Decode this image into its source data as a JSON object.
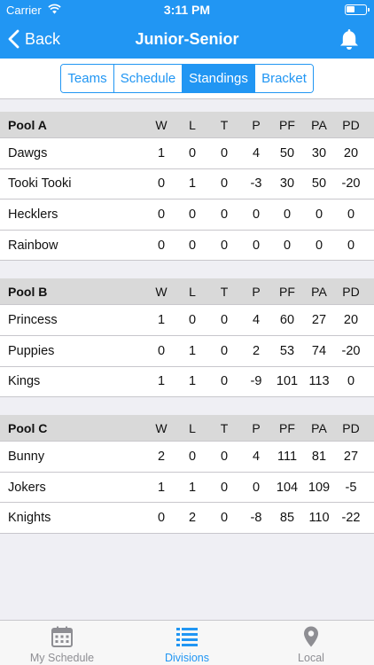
{
  "status_bar": {
    "carrier": "Carrier",
    "time": "3:11 PM"
  },
  "nav": {
    "back_label": "Back",
    "title": "Junior-Senior"
  },
  "segments": [
    {
      "label": "Teams",
      "selected": false
    },
    {
      "label": "Schedule",
      "selected": false
    },
    {
      "label": "Standings",
      "selected": true
    },
    {
      "label": "Bracket",
      "selected": false
    }
  ],
  "columns": [
    "W",
    "L",
    "T",
    "P",
    "PF",
    "PA",
    "PD"
  ],
  "pools": [
    {
      "name": "Pool A",
      "teams": [
        {
          "name": "Dawgs",
          "stats": [
            "1",
            "0",
            "0",
            "4",
            "50",
            "30",
            "20"
          ]
        },
        {
          "name": "Tooki Tooki",
          "stats": [
            "0",
            "1",
            "0",
            "-3",
            "30",
            "50",
            "-20"
          ]
        },
        {
          "name": "Hecklers",
          "stats": [
            "0",
            "0",
            "0",
            "0",
            "0",
            "0",
            "0"
          ]
        },
        {
          "name": "Rainbow",
          "stats": [
            "0",
            "0",
            "0",
            "0",
            "0",
            "0",
            "0"
          ]
        }
      ]
    },
    {
      "name": "Pool B",
      "teams": [
        {
          "name": "Princess",
          "stats": [
            "1",
            "0",
            "0",
            "4",
            "60",
            "27",
            "20"
          ]
        },
        {
          "name": "Puppies",
          "stats": [
            "0",
            "1",
            "0",
            "2",
            "53",
            "74",
            "-20"
          ]
        },
        {
          "name": "Kings",
          "stats": [
            "1",
            "1",
            "0",
            "-9",
            "101",
            "113",
            "0"
          ]
        }
      ]
    },
    {
      "name": "Pool C",
      "teams": [
        {
          "name": "Bunny",
          "stats": [
            "2",
            "0",
            "0",
            "4",
            "111",
            "81",
            "27"
          ]
        },
        {
          "name": "Jokers",
          "stats": [
            "1",
            "1",
            "0",
            "0",
            "104",
            "109",
            "-5"
          ]
        },
        {
          "name": "Knights",
          "stats": [
            "0",
            "2",
            "0",
            "-8",
            "85",
            "110",
            "-22"
          ]
        }
      ]
    }
  ],
  "tabs": [
    {
      "label": "My Schedule",
      "icon": "calendar-icon",
      "active": false
    },
    {
      "label": "Divisions",
      "icon": "list-icon",
      "active": true
    },
    {
      "label": "Local",
      "icon": "location-pin-icon",
      "active": false
    }
  ],
  "colors": {
    "accent": "#2196f3",
    "pool_header_bg": "#d9d9d9",
    "inactive_tab": "#8e8e93",
    "background": "#efeff4"
  }
}
